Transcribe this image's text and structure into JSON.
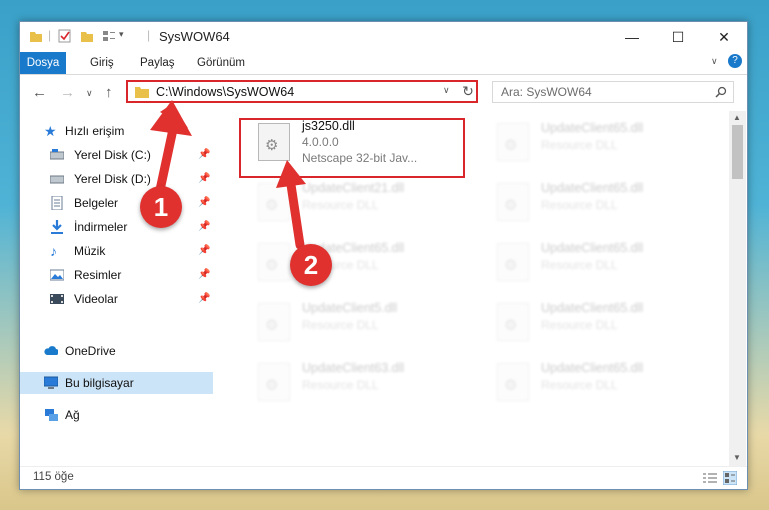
{
  "window": {
    "title": "SysWOW64"
  },
  "ribbon": {
    "tabs": [
      "Dosya",
      "Giriş",
      "Paylaş",
      "Görünüm"
    ]
  },
  "address": {
    "path": "C:\\Windows\\SysWOW64"
  },
  "search": {
    "placeholder": "Ara: SysWOW64"
  },
  "sidebar": {
    "quick_access": "Hızlı erişim",
    "pinned": [
      {
        "label": "Yerel Disk (C:)",
        "icon": "drive-icon"
      },
      {
        "label": "Yerel Disk (D:)",
        "icon": "drive-icon"
      },
      {
        "label": "Belgeler",
        "icon": "documents-icon"
      },
      {
        "label": "İndirmeler",
        "icon": "download-icon"
      },
      {
        "label": "Müzik",
        "icon": "music-icon"
      },
      {
        "label": "Resimler",
        "icon": "pictures-icon"
      },
      {
        "label": "Videolar",
        "icon": "videos-icon"
      }
    ],
    "onedrive": "OneDrive",
    "this_pc": "Bu bilgisayar",
    "network": "Ağ"
  },
  "files": [
    {
      "name": "js3250.dll",
      "version": "4.0.0.0",
      "description": "Netscape 32-bit Jav..."
    },
    {
      "name": "UpdateClient65.dll",
      "description": "Resource DLL"
    },
    {
      "name": "UpdateClient21.dll",
      "description": "Resource DLL"
    },
    {
      "name": "UpdateClient65.dll",
      "description": "Resource DLL"
    },
    {
      "name": "UpdateClient65.dll",
      "description": "Resource DLL"
    },
    {
      "name": "UpdateClient65.dll",
      "description": "Resource DLL"
    },
    {
      "name": "UpdateClient5.dll",
      "description": "Resource DLL"
    },
    {
      "name": "UpdateClient65.dll",
      "description": "Resource DLL"
    },
    {
      "name": "UpdateClient63.dll",
      "description": "Resource DLL"
    },
    {
      "name": "UpdateClient65.dll",
      "description": "Resource DLL"
    }
  ],
  "status": {
    "item_count": "115 öğe"
  },
  "callouts": {
    "one": "1",
    "two": "2"
  },
  "colors": {
    "accent": "#1979ca",
    "highlight": "#d9262b",
    "selected": "#cce4f7"
  }
}
